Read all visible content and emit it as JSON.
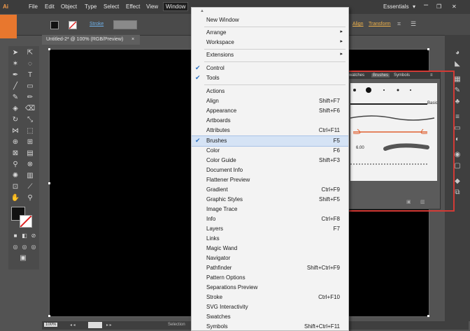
{
  "menubar": {
    "items": [
      "File",
      "Edit",
      "Object",
      "Type",
      "Select",
      "Effect",
      "View",
      "Window"
    ],
    "workspace": "Essentials",
    "ai_logo": "Ai"
  },
  "control": {
    "stroke_label": "Stroke",
    "align_label": "Align",
    "transform_label": "Transform"
  },
  "document": {
    "tab_title": "Untitled-2* @ 100% (RGB/Preview)",
    "zoom": "100%",
    "status": "Selection"
  },
  "brushes_panel": {
    "tabs": [
      "Swatches",
      "Brushes",
      "Symbols"
    ],
    "basic_label": "Basic",
    "size_label": "6.00"
  },
  "window_menu": {
    "items": [
      {
        "label": "New Window",
        "shortcut": "",
        "checked": false,
        "submenu": false
      },
      {
        "label": "Arrange",
        "shortcut": "",
        "checked": false,
        "submenu": true
      },
      {
        "label": "Workspace",
        "shortcut": "",
        "checked": false,
        "submenu": true
      },
      {
        "label": "Extensions",
        "shortcut": "",
        "checked": false,
        "submenu": true
      },
      {
        "label": "Control",
        "shortcut": "",
        "checked": true,
        "submenu": false
      },
      {
        "label": "Tools",
        "shortcut": "",
        "checked": true,
        "submenu": false
      },
      {
        "label": "Actions",
        "shortcut": "",
        "checked": false,
        "submenu": false
      },
      {
        "label": "Align",
        "shortcut": "Shift+F7",
        "checked": false,
        "submenu": false
      },
      {
        "label": "Appearance",
        "shortcut": "Shift+F6",
        "checked": false,
        "submenu": false
      },
      {
        "label": "Artboards",
        "shortcut": "",
        "checked": false,
        "submenu": false
      },
      {
        "label": "Attributes",
        "shortcut": "Ctrl+F11",
        "checked": false,
        "submenu": false
      },
      {
        "label": "Brushes",
        "shortcut": "F5",
        "checked": true,
        "submenu": false,
        "highlighted": true
      },
      {
        "label": "Color",
        "shortcut": "F6",
        "checked": false,
        "submenu": false
      },
      {
        "label": "Color Guide",
        "shortcut": "Shift+F3",
        "checked": false,
        "submenu": false
      },
      {
        "label": "Document Info",
        "shortcut": "",
        "checked": false,
        "submenu": false
      },
      {
        "label": "Flattener Preview",
        "shortcut": "",
        "checked": false,
        "submenu": false
      },
      {
        "label": "Gradient",
        "shortcut": "Ctrl+F9",
        "checked": false,
        "submenu": false
      },
      {
        "label": "Graphic Styles",
        "shortcut": "Shift+F5",
        "checked": false,
        "submenu": false
      },
      {
        "label": "Image Trace",
        "shortcut": "",
        "checked": false,
        "submenu": false
      },
      {
        "label": "Info",
        "shortcut": "Ctrl+F8",
        "checked": false,
        "submenu": false
      },
      {
        "label": "Layers",
        "shortcut": "F7",
        "checked": false,
        "submenu": false
      },
      {
        "label": "Links",
        "shortcut": "",
        "checked": false,
        "submenu": false
      },
      {
        "label": "Magic Wand",
        "shortcut": "",
        "checked": false,
        "submenu": false
      },
      {
        "label": "Navigator",
        "shortcut": "",
        "checked": false,
        "submenu": false
      },
      {
        "label": "Pathfinder",
        "shortcut": "Shift+Ctrl+F9",
        "checked": false,
        "submenu": false
      },
      {
        "label": "Pattern Options",
        "shortcut": "",
        "checked": false,
        "submenu": false
      },
      {
        "label": "Separations Preview",
        "shortcut": "",
        "checked": false,
        "submenu": false
      },
      {
        "label": "Stroke",
        "shortcut": "Ctrl+F10",
        "checked": false,
        "submenu": false
      },
      {
        "label": "SVG Interactivity",
        "shortcut": "",
        "checked": false,
        "submenu": false
      },
      {
        "label": "Swatches",
        "shortcut": "",
        "checked": false,
        "submenu": false
      },
      {
        "label": "Symbols",
        "shortcut": "Shift+Ctrl+F11",
        "checked": false,
        "submenu": false
      }
    ]
  },
  "colors": {
    "menu_highlight": "#d5e3f5",
    "annotation_box": "#d23a35",
    "accent_orange": "#e8772e"
  }
}
